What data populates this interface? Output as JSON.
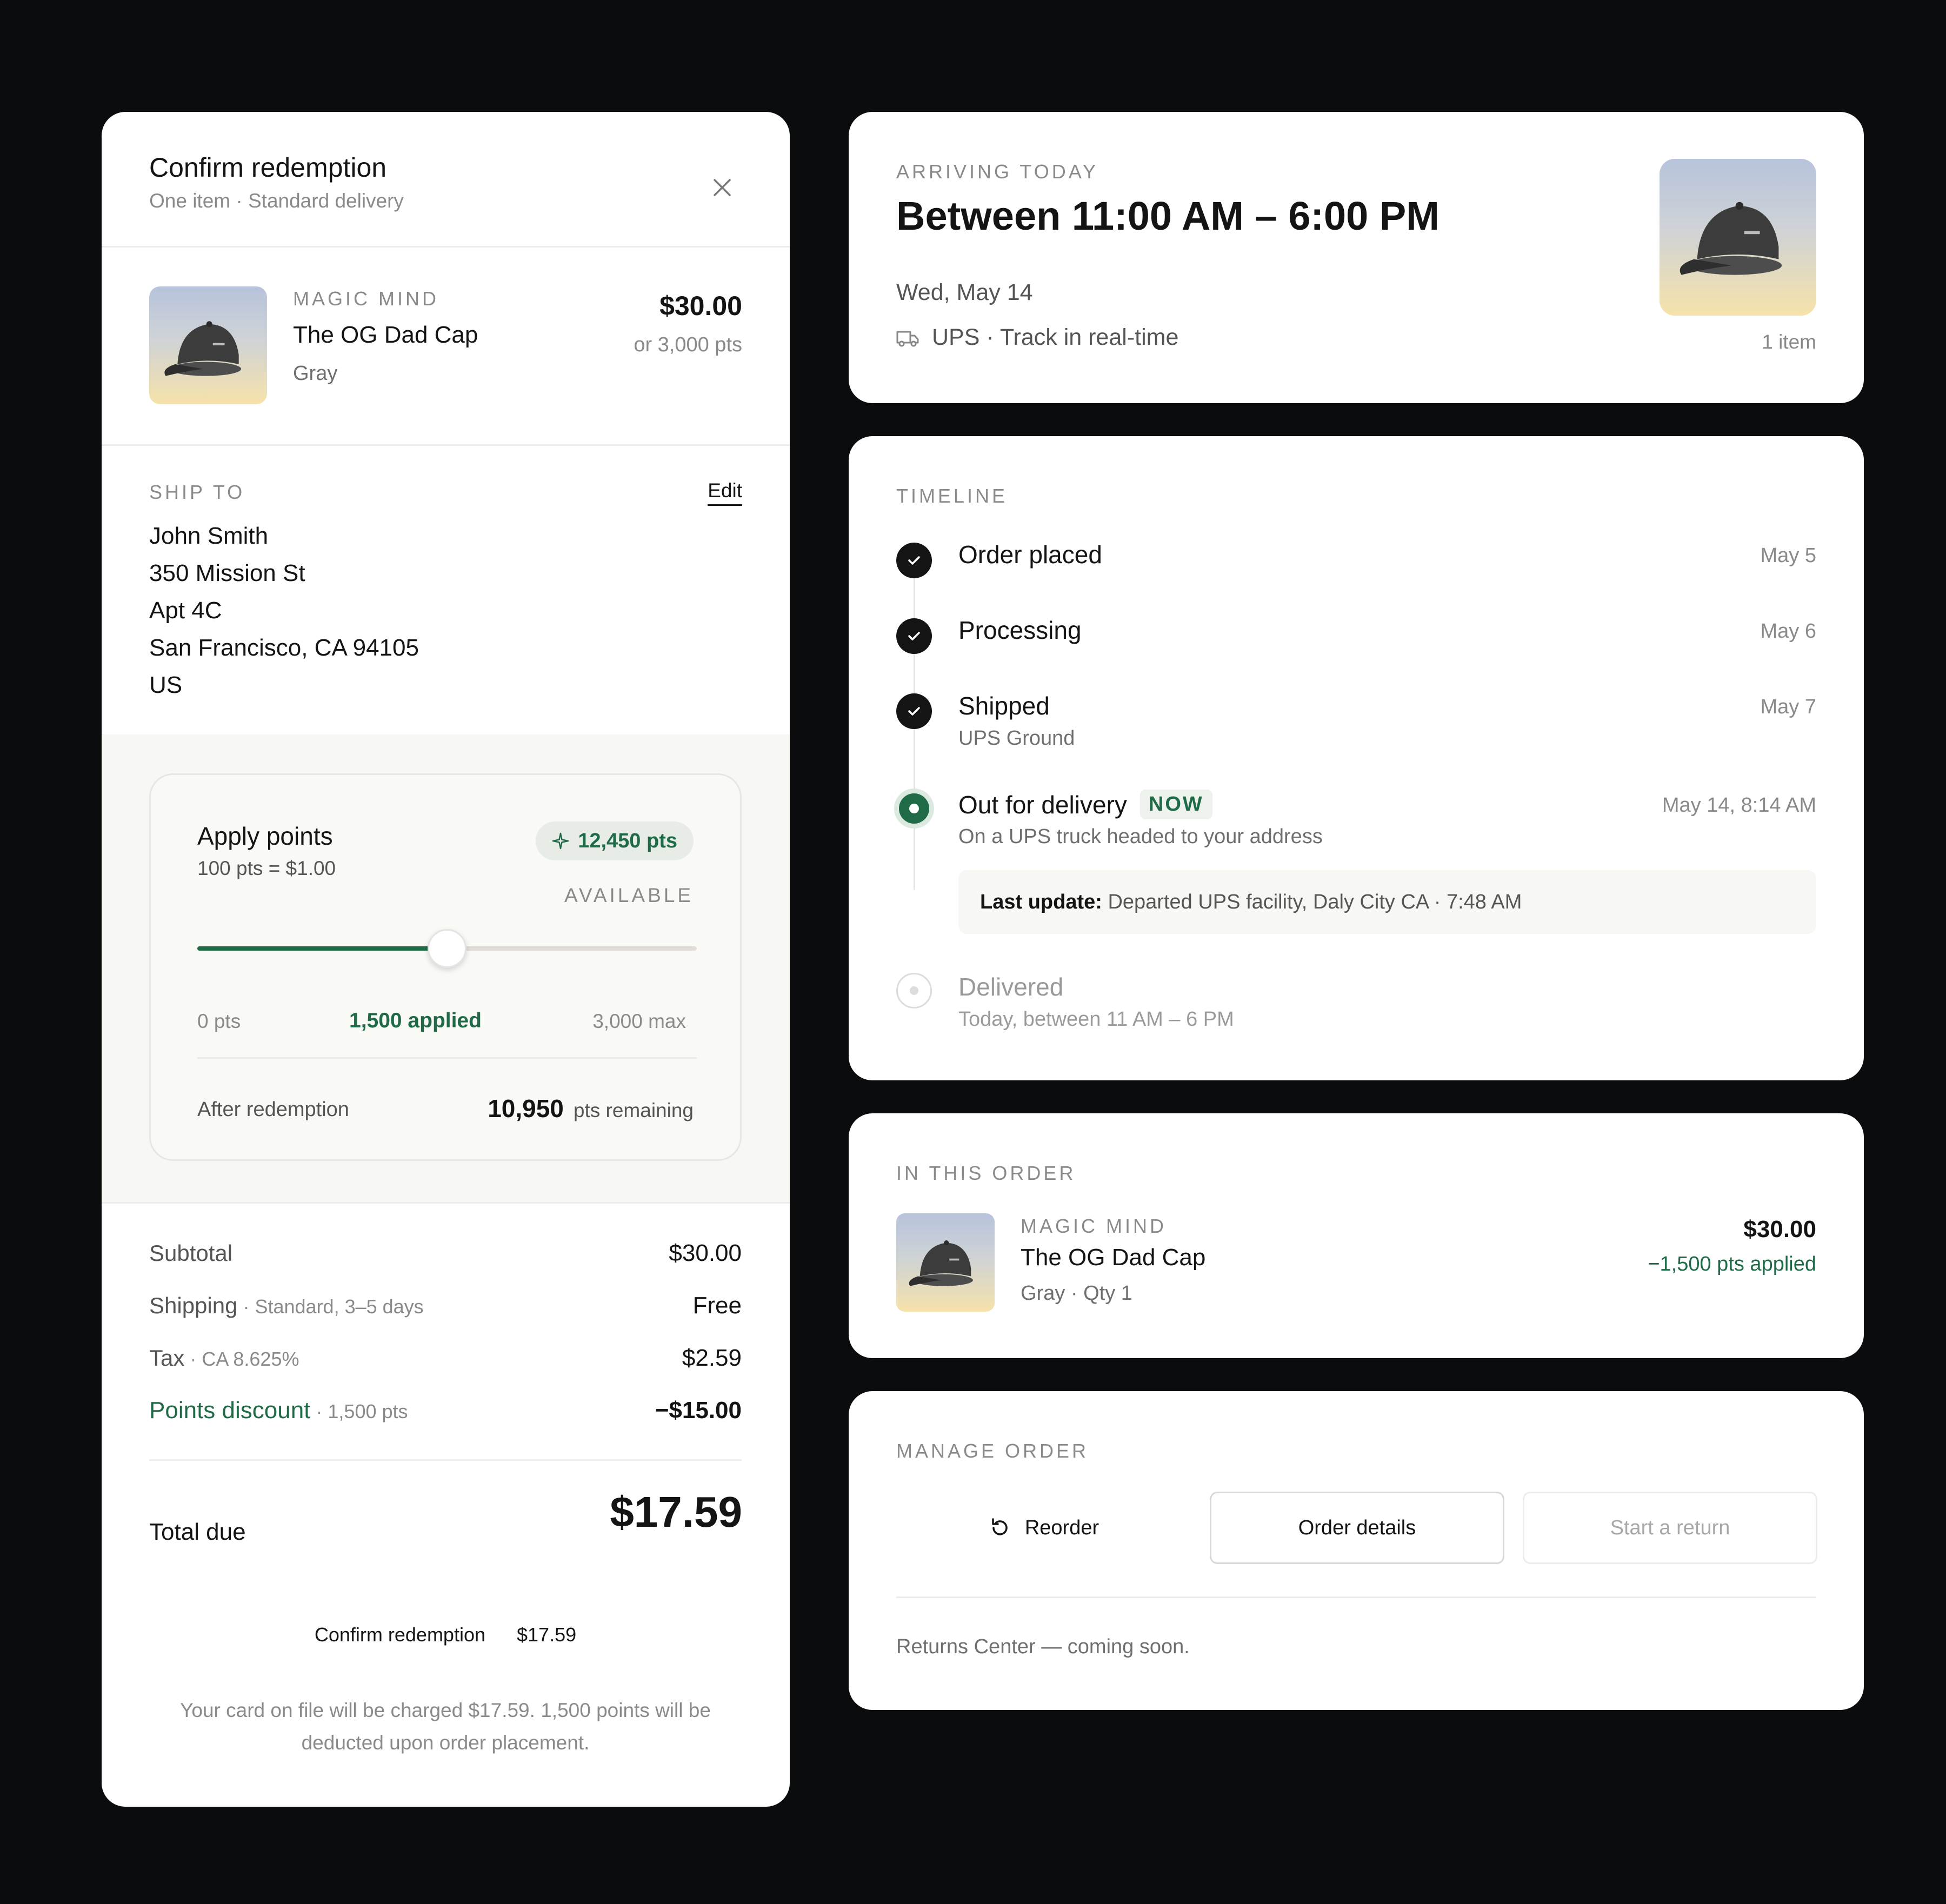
{
  "confirm": {
    "title": "Confirm redemption",
    "subtitle": "One item · Standard delivery",
    "product": {
      "brand": "MAGIC MIND",
      "name": "The OG Dad Cap",
      "variant": "Gray",
      "price": "$30.00",
      "price_pts": "or 3,000 pts"
    },
    "ship_to": {
      "label": "SHIP TO",
      "edit_label": "Edit",
      "lines": [
        "John Smith",
        "350 Mission St",
        "Apt 4C",
        "San Francisco, CA 94105",
        "US"
      ]
    },
    "points": {
      "title": "Apply points",
      "rate": "100 pts = $1.00",
      "balance": "12,450 pts",
      "balance_label": "AVAILABLE",
      "slider_fraction": 0.5,
      "min_label": "0 pts",
      "applied_label": "1,500 applied",
      "max_label": "3,000 max",
      "after_label": "After redemption",
      "remaining_value": "10,950",
      "remaining_suffix": "pts remaining"
    },
    "summary": {
      "subtotal_label": "Subtotal",
      "subtotal_value": "$30.00",
      "shipping_label": "Shipping",
      "shipping_note": " · Standard, 3–5 days",
      "shipping_value": "Free",
      "tax_label": "Tax",
      "tax_note": " · CA 8.625%",
      "tax_value": "$2.59",
      "discount_label": "Points discount",
      "discount_note": " · 1,500 pts",
      "discount_value": "−$15.00",
      "total_label": "Total due",
      "total_value": "$17.59"
    },
    "cta": {
      "label": "Confirm redemption",
      "amount": "$17.59"
    },
    "footnote": "Your card on file will be charged $17.59. 1,500 points will be deducted upon order placement."
  },
  "arrival": {
    "eyebrow": "ARRIVING TODAY",
    "window": "Between 11:00 AM – 6:00 PM",
    "date": "Wed, May 14",
    "carrier": "UPS · Track in real-time",
    "item_count": "1 item"
  },
  "timeline": {
    "eyebrow": "TIMELINE",
    "steps": [
      {
        "title": "Order placed",
        "date": "May 5"
      },
      {
        "title": "Processing",
        "date": "May 6"
      },
      {
        "title": "Shipped",
        "sub": "UPS Ground",
        "date": "May 7"
      },
      {
        "title": "Out for delivery",
        "badge": "NOW",
        "sub": "On a UPS truck headed to your address",
        "date": "May 14, 8:14 AM"
      },
      {
        "title": "Delivered",
        "sub": "Today, between 11 AM – 6 PM"
      }
    ],
    "last_update_label": "Last update:",
    "last_update_text": " Departed UPS facility, Daly City CA · 7:48 AM"
  },
  "order": {
    "eyebrow": "IN THIS ORDER",
    "brand": "MAGIC MIND",
    "name": "The OG Dad Cap",
    "variant": "Gray · Qty 1",
    "price": "$30.00",
    "points_applied": "−1,500 pts applied"
  },
  "manage": {
    "eyebrow": "MANAGE ORDER",
    "reorder_label": "Reorder",
    "details_label": "Order details",
    "return_label": "Start a return",
    "note": "Returns Center — coming soon."
  },
  "colors": {
    "accent": "#1f6b47",
    "background": "#0a0c0d",
    "card": "#ffffff"
  },
  "icons": [
    "close-icon",
    "sparkle-icon",
    "truck-icon",
    "check-icon",
    "reorder-icon",
    "cap-image"
  ]
}
